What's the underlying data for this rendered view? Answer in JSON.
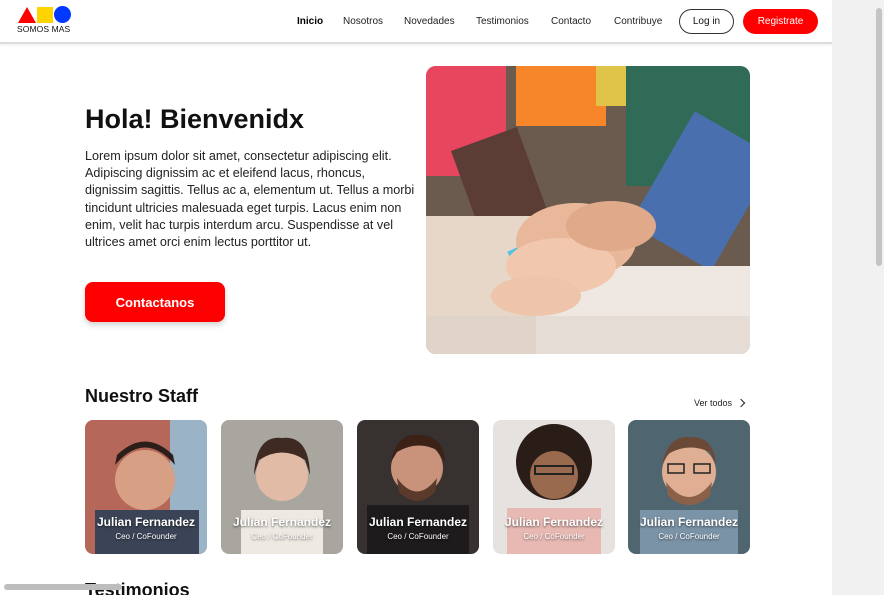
{
  "brand": {
    "name": "SOMOS MAS",
    "colors": {
      "red": "#ff0000",
      "yellow": "#ffd400",
      "blue": "#0038ff"
    }
  },
  "nav": {
    "items": [
      {
        "label": "Inicio",
        "active": true
      },
      {
        "label": "Nosotros"
      },
      {
        "label": "Novedades"
      },
      {
        "label": "Testimonios"
      },
      {
        "label": "Contacto"
      },
      {
        "label": "Contribuye"
      }
    ],
    "login_label": "Log in",
    "register_label": "Registrate"
  },
  "hero": {
    "title": "Hola!  Bienvenidx",
    "text": "Lorem ipsum dolor sit amet, consectetur adipiscing elit. Adipiscing dignissim ac et eleifend lacus, rhoncus, dignissim sagittis. Tellus ac a, elementum ut. Tellus a morbi tincidunt ultricies malesuada eget turpis. Lacus enim non enim, velit hac turpis interdum arcu. Suspendisse at vel ultrices amet orci enim lectus porttitor ut.",
    "cta_label": "Contactanos",
    "image": "hands-together-photo"
  },
  "staff": {
    "title": "Nuestro Staff",
    "see_all_label": "Ver todos",
    "members": [
      {
        "name": "Julian Fernandez",
        "role": "Ceo / CoFounder"
      },
      {
        "name": "Julian Fernandez",
        "role": "Ceo / CoFounder"
      },
      {
        "name": "Julian Fernandez",
        "role": "Ceo / CoFounder"
      },
      {
        "name": "Julian Fernandez",
        "role": "Ceo / CoFounder"
      },
      {
        "name": "Julian Fernandez",
        "role": "Ceo / CoFounder"
      }
    ]
  },
  "testimonials": {
    "title": "Testimonios"
  }
}
